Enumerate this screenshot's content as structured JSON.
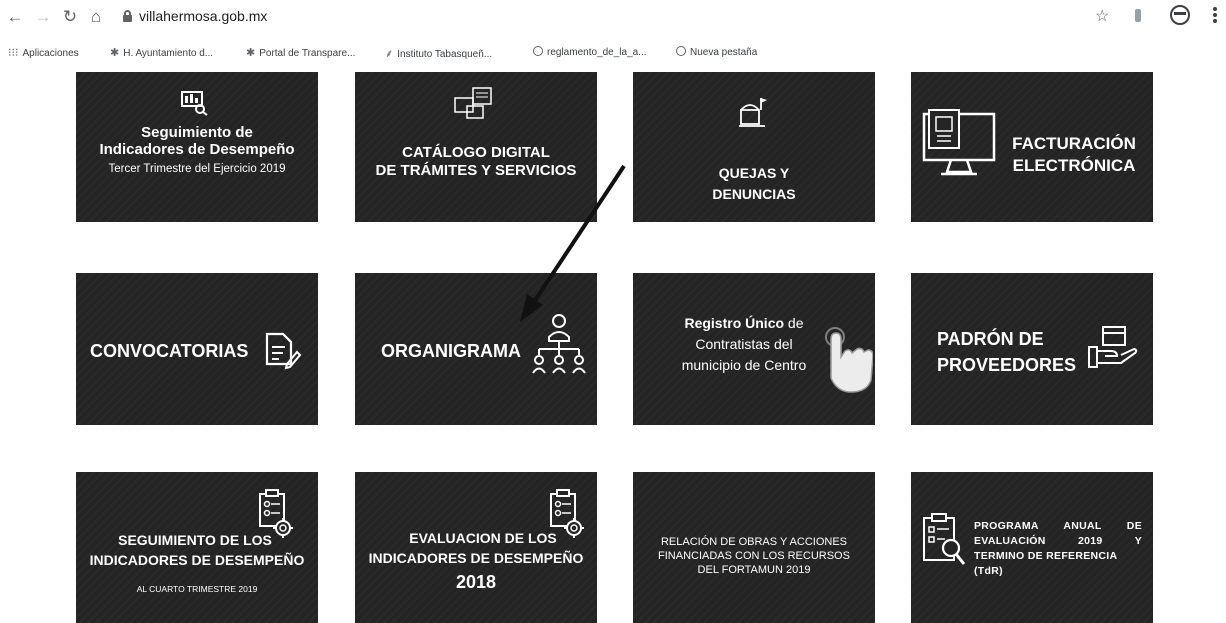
{
  "browser": {
    "url": "villahermosa.gob.mx",
    "bookmarks": [
      {
        "label": "Aplicaciones",
        "icon": "apps-grid-icon"
      },
      {
        "label": "H. Ayuntamiento d...",
        "icon": "palm-tree-icon"
      },
      {
        "label": "Portal de Transpare...",
        "icon": "palm-tree-icon"
      },
      {
        "label": "Instituto Tabasqueñ...",
        "icon": "feather-icon"
      },
      {
        "label": "reglamento_de_la_a...",
        "icon": "globe-icon"
      },
      {
        "label": "Nueva pestaña",
        "icon": "globe-icon"
      }
    ]
  },
  "tiles": {
    "seguimiento_tercer": {
      "line1": "Seguimiento de",
      "line2": "Indicadores de Desempeño",
      "line3": "Tercer Trimestre del Ejercicio 2019",
      "icon": "report-search-icon"
    },
    "catalogo": {
      "line1": "CATÁLOGO DIGITAL",
      "line2": "DE TRÁMITES Y SERVICIOS",
      "icon": "document-windows-icon"
    },
    "quejas": {
      "line1": "QUEJAS Y",
      "line2": "DENUNCIAS",
      "icon": "mailbox-icon"
    },
    "facturacion": {
      "line1": "FACTURACIÓN",
      "line2": "ELECTRÓNICA",
      "icon": "computer-monitor-icon"
    },
    "convocatorias": {
      "label": "CONVOCATORIAS",
      "icon": "document-pen-icon"
    },
    "organigrama": {
      "label": "ORGANIGRAMA",
      "icon": "org-chart-icon"
    },
    "registro": {
      "line1a": "Registro Único",
      "line1b": " de",
      "line2": "Contratistas del",
      "line3": "municipio de Centro",
      "icon": "pointing-hand-icon"
    },
    "padron": {
      "line1": "PADRÓN DE",
      "line2": "PROVEEDORES",
      "icon": "hand-box-icon"
    },
    "seguimiento_cuarto": {
      "line1": "SEGUIMIENTO DE LOS",
      "line2": "INDICADORES DE DESEMPEÑO",
      "line3": "AL CUARTO TRIMESTRE 2019",
      "icon": "clipboard-gear-icon"
    },
    "evaluacion": {
      "line1": "EVALUACION DE LOS",
      "line2": "INDICADORES DE DESEMPEÑO",
      "line3": "2018",
      "icon": "clipboard-gear-icon"
    },
    "relacion": {
      "line1": "RELACIÓN DE OBRAS Y ACCIONES",
      "line2": "FINANCIADAS CON LOS RECURSOS",
      "line3": "DEL FORTAMUN 2019"
    },
    "programa": {
      "line1": "PROGRAMA ANUAL DE",
      "line2": "EVALUACIÓN 2019 Y",
      "line3": "TERMINO DE REFERENCIA",
      "line4": "(TdR)",
      "icon": "clipboard-magnifier-icon"
    }
  },
  "colors": {
    "tile_bg": "#242424",
    "text": "#ffffff",
    "arrow": "#111111"
  }
}
